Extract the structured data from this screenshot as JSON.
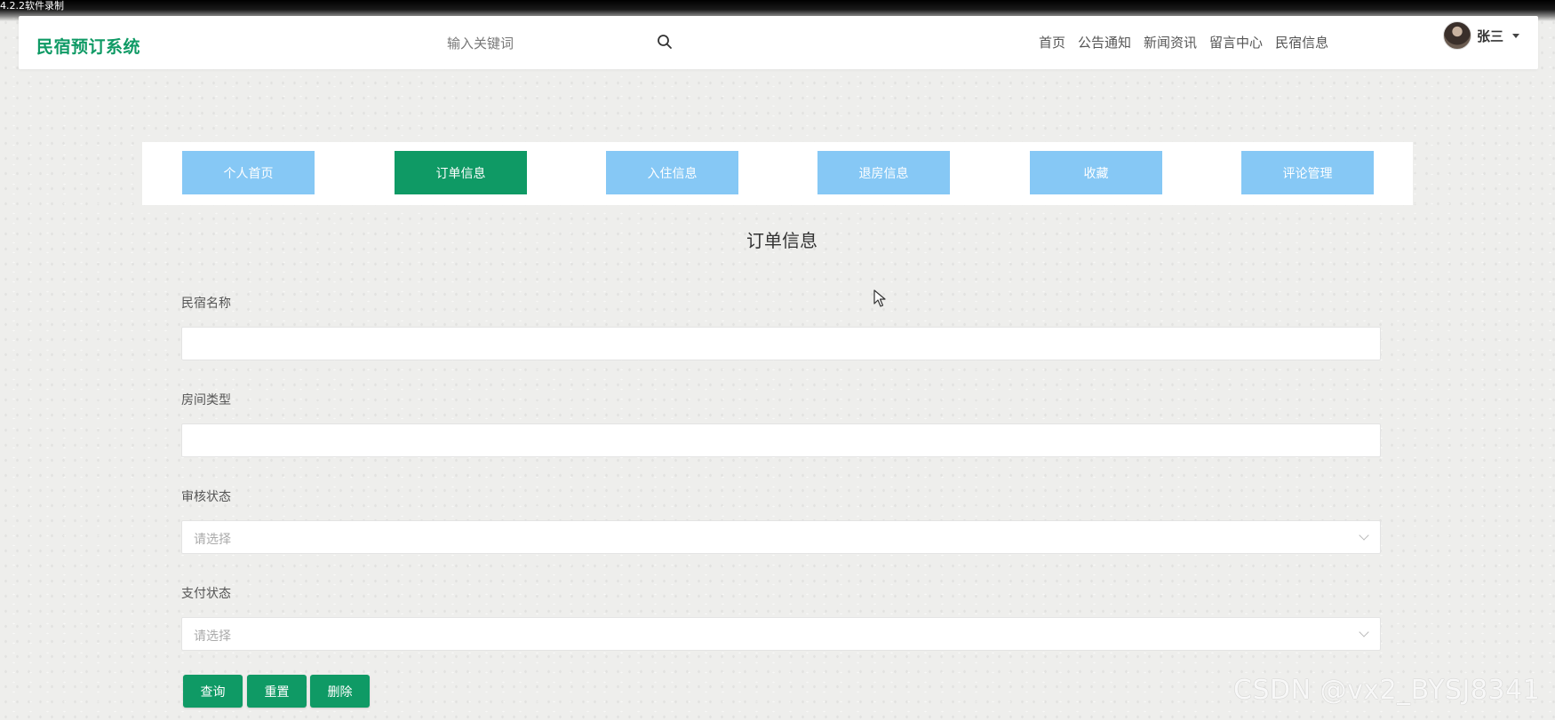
{
  "recording_title": "4.2.2软件录制",
  "header": {
    "logo": "民宿预订系统",
    "search": {
      "placeholder": "输入关键词"
    },
    "nav": [
      {
        "label": "首页"
      },
      {
        "label": "公告通知"
      },
      {
        "label": "新闻资讯"
      },
      {
        "label": "留言中心"
      },
      {
        "label": "民宿信息"
      }
    ],
    "user": {
      "name": "张三"
    }
  },
  "tabs": [
    {
      "label": "个人首页",
      "active": false
    },
    {
      "label": "订单信息",
      "active": true
    },
    {
      "label": "入住信息",
      "active": false
    },
    {
      "label": "退房信息",
      "active": false
    },
    {
      "label": "收藏",
      "active": false
    },
    {
      "label": "评论管理",
      "active": false
    }
  ],
  "page_title": "订单信息",
  "form": {
    "homestay_name": {
      "label": "民宿名称",
      "value": ""
    },
    "room_type": {
      "label": "房间类型",
      "value": ""
    },
    "review_status": {
      "label": "审核状态",
      "placeholder": "请选择"
    },
    "payment_status": {
      "label": "支付状态",
      "placeholder": "请选择"
    }
  },
  "buttons": {
    "query": "查询",
    "reset": "重置",
    "delete": "删除"
  },
  "watermark": "CSDN @vx2_BYSJ8341",
  "colors": {
    "brand_green": "#0f9a65",
    "tab_blue": "#86c8f5"
  }
}
